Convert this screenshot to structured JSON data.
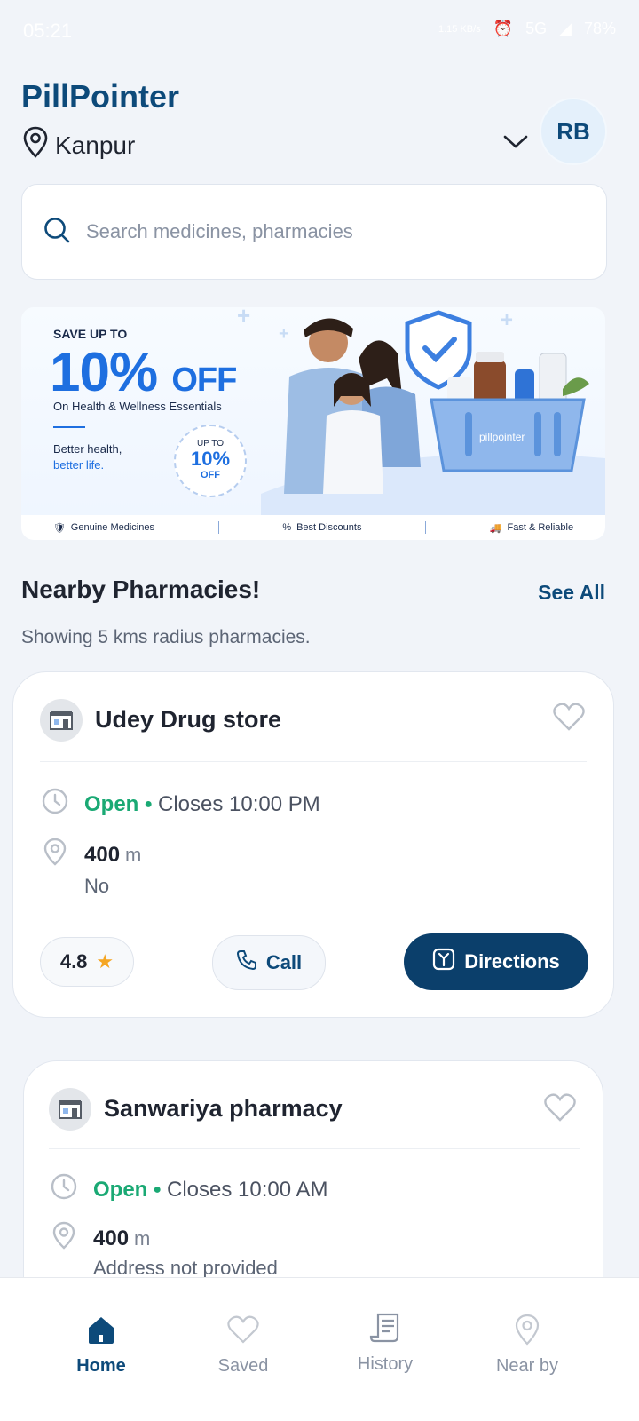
{
  "status_bar": {
    "time": "05:21",
    "speed": "1.15 KB/s",
    "network": "5G",
    "battery": "78%"
  },
  "header": {
    "app_title": "PillPointer",
    "location": "Kanpur",
    "avatar_initials": "RB"
  },
  "search": {
    "placeholder": "Search medicines, pharmacies"
  },
  "banner": {
    "save_up_to": "SAVE UP TO",
    "discount": "10%",
    "off": "OFF",
    "subtitle": "On Health & Wellness Essentials",
    "tagline_1": "Better health,",
    "tagline_2": "better life.",
    "badge_top": "UP TO",
    "badge_value": "10%",
    "badge_bottom": "OFF",
    "strip": [
      "Genuine Medicines",
      "Best Discounts",
      "Fast & Reliable"
    ]
  },
  "nearby": {
    "title": "Nearby Pharmacies!",
    "see_all": "See All",
    "subtitle": "Showing 5 kms radius pharmacies."
  },
  "pharmacies": [
    {
      "name": "Udey Drug store",
      "status": "Open",
      "closes": "Closes 10:00 PM",
      "distance": "400",
      "unit": "m",
      "address": "No",
      "rating": "4.8",
      "call_label": "Call",
      "directions_label": "Directions"
    },
    {
      "name": "Sanwariya pharmacy",
      "status": "Open",
      "closes": "Closes 10:00 AM",
      "distance": "400",
      "unit": "m",
      "address": "Address not provided"
    }
  ],
  "nav": {
    "home": "Home",
    "saved": "Saved",
    "history": "History",
    "nearby": "Near by"
  },
  "colors": {
    "brand": "#0d4a7a",
    "open": "#1aa974",
    "accent": "#1e6fe0"
  }
}
